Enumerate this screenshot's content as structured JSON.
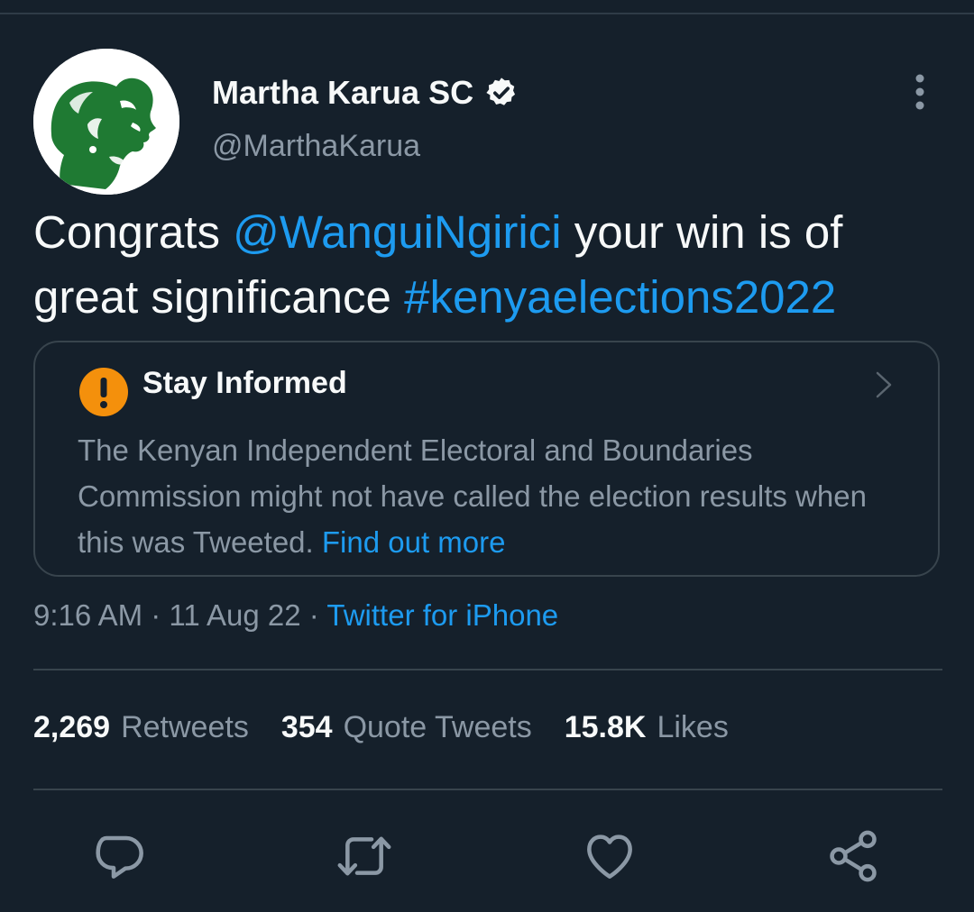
{
  "author": {
    "display_name": "Martha Karua SC",
    "handle": "@MarthaKarua",
    "verified": true
  },
  "tweet": {
    "text_before": "Congrats ",
    "mention": "@WanguiNgirici",
    "text_middle": " your win is of great significance ",
    "hashtag": "#kenyaelections2022"
  },
  "notice": {
    "title": "Stay Informed",
    "body": "The Kenyan Independent Electoral and Boundaries Commission might not have called the election results when this was Tweeted.",
    "link": "Find out more"
  },
  "meta": {
    "time": "9:16 AM",
    "date": "11 Aug 22",
    "separator": "·",
    "source": "Twitter for iPhone"
  },
  "stats": {
    "retweets_count": "2,269",
    "retweets_label": "Retweets",
    "quotes_count": "354",
    "quotes_label": "Quote Tweets",
    "likes_count": "15.8K",
    "likes_label": "Likes"
  },
  "icons": {
    "reply": "reply-icon",
    "retweet": "retweet-icon",
    "like": "like-icon",
    "share": "share-icon",
    "more": "more-vertical-icon",
    "verified": "verified-badge-icon",
    "notice": "exclamation-icon",
    "chevron": "chevron-right-icon"
  },
  "colors": {
    "background": "#15202b",
    "text_primary": "#f7f9f9",
    "text_secondary": "#8b98a5",
    "link": "#1d9bf0",
    "notice_icon": "#f4900c",
    "avatar_art": "#1f7a33"
  }
}
